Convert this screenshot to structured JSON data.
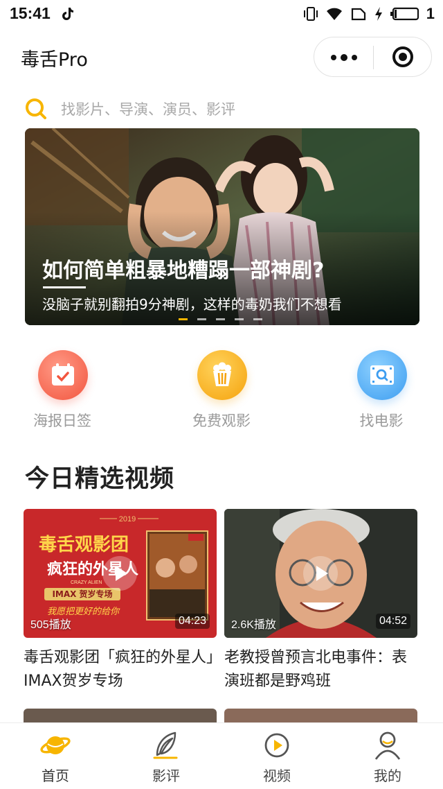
{
  "status_bar": {
    "time": "15:41",
    "battery_level": "1",
    "icons": [
      "tiktok-icon",
      "vibrate-icon",
      "wifi-icon",
      "sim-icon",
      "charging-icon",
      "battery-icon"
    ]
  },
  "navbar": {
    "title": "毒舌Pro",
    "capsule_icons": [
      "more-icon",
      "close-target-icon"
    ]
  },
  "search": {
    "placeholder": "找影片、导演、演员、影评",
    "icon": "search-icon",
    "accent": "#f7b500"
  },
  "banner": {
    "title": "如何简单粗暴地糟蹋一部神剧?",
    "subtitle": "没脑子就别翻拍9分神剧，这样的毒奶我们不想看",
    "slide_count": 5,
    "active_index": 0
  },
  "quick_entries": [
    {
      "label": "海报日签",
      "icon": "calendar-icon",
      "color": "#f2553e"
    },
    {
      "label": "免费观影",
      "icon": "popcorn-icon",
      "color": "#f5a20c"
    },
    {
      "label": "找电影",
      "icon": "film-search-icon",
      "color": "#3d9df0"
    }
  ],
  "section": {
    "title": "今日精选视频"
  },
  "videos": [
    {
      "title": "毒舌观影团「疯狂的外星人」IMAX贺岁专场",
      "plays": "505播放",
      "duration": "04:23",
      "thumb_text": {
        "year": "2019",
        "brand": "毒舌观影团",
        "movie": "疯狂的外星人",
        "movie_en": "CRAZY ALIEN",
        "tag": "IMAX 贺岁专场",
        "slogan": "我愿把更好的给你"
      }
    },
    {
      "title": "老教授曾预言北电事件：表演班都是野鸡班",
      "plays": "2.6K播放",
      "duration": "04:52"
    }
  ],
  "tabbar": {
    "items": [
      {
        "label": "首页",
        "icon": "planet-icon",
        "active": true
      },
      {
        "label": "影评",
        "icon": "quill-icon",
        "active": false
      },
      {
        "label": "视频",
        "icon": "video-play-icon",
        "active": false
      },
      {
        "label": "我的",
        "icon": "user-icon",
        "active": false
      }
    ],
    "active_color": "#f7b500"
  }
}
